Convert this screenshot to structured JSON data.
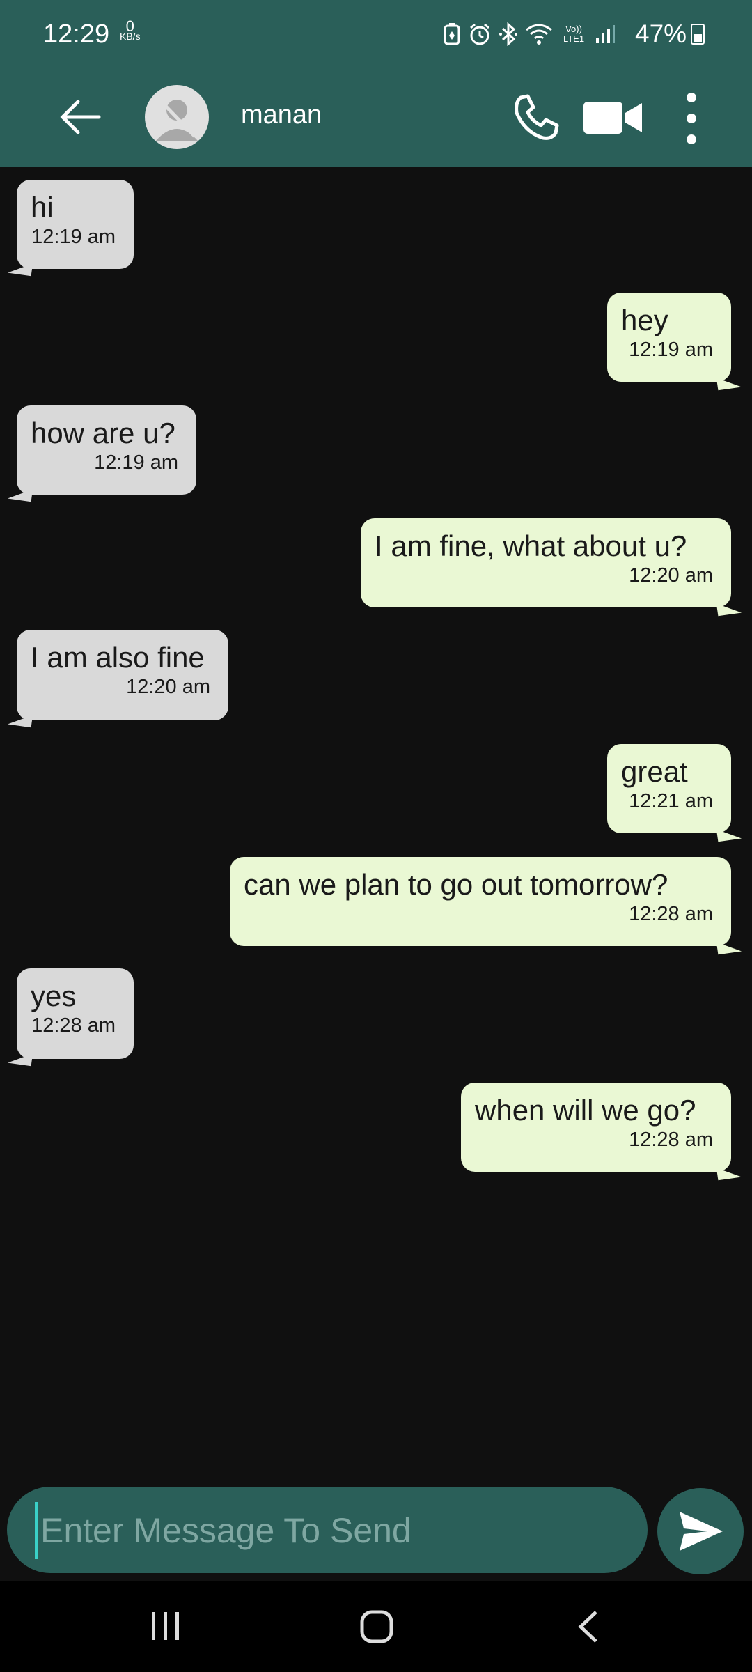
{
  "status_bar": {
    "time": "12:29",
    "data_speed_value": "0",
    "data_speed_unit": "KB/s",
    "network_label": "Vo)) LTE1",
    "battery": "47%",
    "icons": [
      "battery-saver-icon",
      "alarm-icon",
      "bluetooth-icon",
      "wifi-icon",
      "volte-icon",
      "signal-icon",
      "battery-icon"
    ]
  },
  "header": {
    "contact_name": "manan",
    "icons": [
      "back-arrow-icon",
      "avatar-icon",
      "phone-icon",
      "video-camera-icon",
      "more-vert-icon"
    ]
  },
  "messages": [
    {
      "dir": "in",
      "text": "hi",
      "time": "12:19 am"
    },
    {
      "dir": "out",
      "text": "hey",
      "time": "12:19 am"
    },
    {
      "dir": "in",
      "text": "how are u?",
      "time": "12:19 am"
    },
    {
      "dir": "out",
      "text": "I am fine, what about u?",
      "time": "12:20 am"
    },
    {
      "dir": "in",
      "text": "I am also fine",
      "time": "12:20 am"
    },
    {
      "dir": "out",
      "text": "great",
      "time": "12:21 am"
    },
    {
      "dir": "out",
      "text": "can we plan to go out tomorrow?",
      "time": "12:28 am"
    },
    {
      "dir": "in",
      "text": "yes",
      "time": "12:28 am"
    },
    {
      "dir": "out",
      "text": "when will we go?",
      "time": "12:28 am"
    }
  ],
  "composer": {
    "placeholder": "Enter Message To Send",
    "value": "",
    "send_icon": "send-icon"
  },
  "nav": {
    "icons": [
      "recent-apps-icon",
      "home-icon",
      "back-icon"
    ]
  },
  "colors": {
    "primary": "#2a5f59",
    "background": "#101010",
    "incoming_bubble": "#d9d9d9",
    "outgoing_bubble": "#eaf8d4"
  }
}
